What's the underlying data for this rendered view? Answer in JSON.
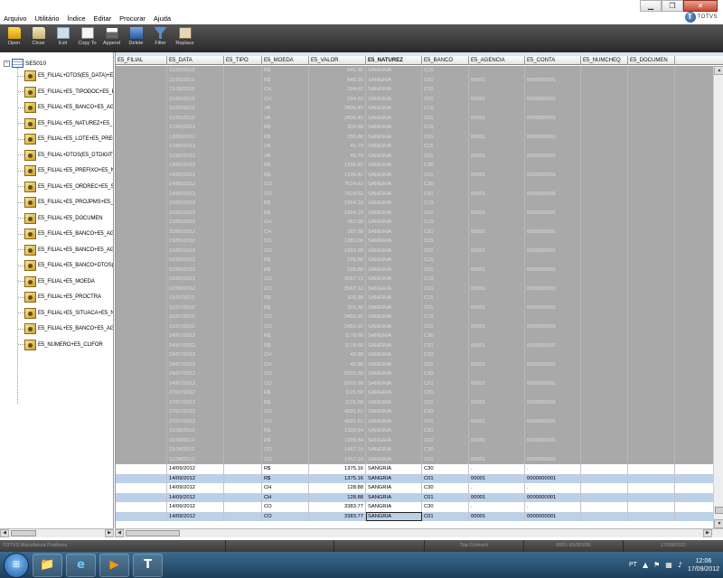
{
  "menu": [
    "Arquivo",
    "Utilitário",
    "Índice",
    "Editar",
    "Procurar",
    "Ajuda"
  ],
  "brand": "TOTVS",
  "toolbar": [
    {
      "label": "Open",
      "icon": "folder-open-icon"
    },
    {
      "label": "Close",
      "icon": "folder-close-icon"
    },
    {
      "label": "Exit",
      "icon": "exit-icon"
    },
    {
      "label": "Copy To",
      "icon": "copy-to-icon"
    },
    {
      "label": "Append",
      "icon": "append-icon"
    },
    {
      "label": "Delete",
      "icon": "delete-icon"
    },
    {
      "label": "Filter",
      "icon": "filter-icon"
    },
    {
      "label": "Replace",
      "icon": "replace-icon"
    }
  ],
  "tree": {
    "root": "SE5010",
    "items": [
      "E5_FILIAL+DTOS(E5_DATA)+E",
      "E5_FILIAL+E5_TIPODOC+E5_P",
      "E5_FILIAL+E5_BANCO+E5_AG",
      "E5_FILIAL+E5_NATUREZ+E5_",
      "E5_FILIAL+E5_LOTE+E5_PREF",
      "E5_FILIAL+DTOS(E5_DTDIGIT)",
      "E5_FILIAL+E5_PREFIXO+E5_N",
      "E5_FILIAL+E5_ORDREC+E5_SE",
      "E5_FILIAL+E5_PROJPMS+E5_",
      "E5_FILIAL+E5_DOCUMEN",
      "E5_FILIAL+E5_BANCO+E5_AG",
      "E5_FILIAL+E5_BANCO+E5_AG",
      "E5_FILIAL+E5_BANCO+DTOS(",
      "E5_FILIAL+E5_MOEDA",
      "E5_FILIAL+E5_PROCTRA",
      "E5_FILIAL+E5_SITUACA+E5_N",
      "E5_FILIAL+E5_BANCO+E5_AG",
      "E5_NUMERO+E5_CLIFOR"
    ]
  },
  "grid": {
    "columns": [
      "E5_FILIAL",
      "E5_DATA",
      "E5_TIPO",
      "E5_MOEDA",
      "E5_VALOR",
      "E5_NATUREZ",
      "E5_BANCO",
      "E5_AGENCIA",
      "E5_CONTA",
      "E5_NUMCHEQ",
      "E5_DOCUMEN"
    ],
    "active_column": "E5_NATUREZ",
    "rows": [
      [
        "",
        "11/05/2012",
        "",
        "R$",
        "845.36",
        "SANGRIA",
        "C15",
        "",
        "",
        "",
        ""
      ],
      [
        "",
        "11/05/2012",
        "",
        "R$",
        "845.36",
        "SANGRIA",
        "C01",
        "00001",
        "0000000001",
        "",
        ""
      ],
      [
        "",
        "11/05/2012",
        "",
        "CH",
        "294.62",
        "SANGRIA",
        "C15",
        "",
        "",
        "",
        ""
      ],
      [
        "",
        "11/05/2012",
        "",
        "CH",
        "294.62",
        "SANGRIA",
        "C01",
        "00001",
        "0000000001",
        "",
        ""
      ],
      [
        "",
        "11/05/2012",
        "",
        "VA",
        "2800.45",
        "SANGRIA",
        "C15",
        "",
        "",
        "",
        ""
      ],
      [
        "",
        "11/05/2012",
        "",
        "VA",
        "2800.45",
        "SANGRIA",
        "C01",
        "00001",
        "0000000001",
        "",
        ""
      ],
      [
        "",
        "12/05/2012",
        "",
        "R$",
        "200.88",
        "SANGRIA",
        "C15",
        "",
        "",
        "",
        ""
      ],
      [
        "",
        "12/05/2012",
        "",
        "R$",
        "200.88",
        "SANGRIA",
        "C01",
        "00001",
        "0000000001",
        "",
        ""
      ],
      [
        "",
        "12/05/2012",
        "",
        "VA",
        "45.79",
        "SANGRIA",
        "C15",
        "",
        "",
        "",
        ""
      ],
      [
        "",
        "12/05/2012",
        "",
        "VA",
        "45.79",
        "SANGRIA",
        "C01",
        "00001",
        "0000000001",
        "",
        ""
      ],
      [
        "",
        "14/05/2012",
        "",
        "R$",
        "1396.82",
        "SANGRIA",
        "C30",
        "",
        "",
        "",
        ""
      ],
      [
        "",
        "14/05/2012",
        "",
        "R$",
        "1396.82",
        "SANGRIA",
        "C01",
        "00001",
        "0000000001",
        "",
        ""
      ],
      [
        "",
        "14/05/2012",
        "",
        "CO",
        "7624.62",
        "SANGRIA",
        "C30",
        "",
        "",
        "",
        ""
      ],
      [
        "",
        "14/05/2012",
        "",
        "CO",
        "7624.62",
        "SANGRIA",
        "C01",
        "00001",
        "0000000001",
        "",
        ""
      ],
      [
        "",
        "23/05/2012",
        "",
        "R$",
        "1864.18",
        "SANGRIA",
        "C15",
        "",
        "",
        "",
        ""
      ],
      [
        "",
        "23/05/2012",
        "",
        "R$",
        "1864.18",
        "SANGRIA",
        "C01",
        "00001",
        "0000000001",
        "",
        ""
      ],
      [
        "",
        "23/05/2012",
        "",
        "CH",
        "367.58",
        "SANGRIA",
        "C15",
        "",
        "",
        "",
        ""
      ],
      [
        "",
        "23/05/2012",
        "",
        "CH",
        "367.58",
        "SANGRIA",
        "C01",
        "00001",
        "0000000001",
        "",
        ""
      ],
      [
        "",
        "23/05/2012",
        "",
        "CO",
        "1683.58",
        "SANGRIA",
        "C15",
        "",
        "",
        "",
        ""
      ],
      [
        "",
        "23/05/2012",
        "",
        "CO",
        "1683.58",
        "SANGRIA",
        "C01",
        "00001",
        "0000000001",
        "",
        ""
      ],
      [
        "",
        "02/06/2012",
        "",
        "R$",
        "226.88",
        "SANGRIA",
        "C15",
        "",
        "",
        "",
        ""
      ],
      [
        "",
        "02/06/2012",
        "",
        "R$",
        "226.88",
        "SANGRIA",
        "C01",
        "00001",
        "0000000001",
        "",
        ""
      ],
      [
        "",
        "02/06/2012",
        "",
        "CO",
        "3567.12",
        "SANGRIA",
        "C15",
        "",
        "",
        "",
        ""
      ],
      [
        "",
        "02/06/2012",
        "",
        "CO",
        "3567.12",
        "SANGRIA",
        "C01",
        "00001",
        "0000000001",
        "",
        ""
      ],
      [
        "",
        "11/07/2012",
        "",
        "R$",
        "326.38",
        "SANGRIA",
        "C15",
        "",
        "",
        "",
        ""
      ],
      [
        "",
        "11/07/2012",
        "",
        "R$",
        "326.38",
        "SANGRIA",
        "C01",
        "00001",
        "0000000001",
        "",
        ""
      ],
      [
        "",
        "11/07/2012",
        "",
        "CO",
        "3456.92",
        "SANGRIA",
        "C15",
        "",
        "",
        "",
        ""
      ],
      [
        "",
        "11/07/2012",
        "",
        "CO",
        "3456.92",
        "SANGRIA",
        "C01",
        "00001",
        "0000000001",
        "",
        ""
      ],
      [
        "",
        "24/07/2012",
        "",
        "R$",
        "1178.66",
        "SANGRIA",
        "C30",
        "",
        "",
        "",
        ""
      ],
      [
        "",
        "24/07/2012",
        "",
        "R$",
        "1178.66",
        "SANGRIA",
        "C01",
        "00001",
        "0000000001",
        "",
        ""
      ],
      [
        "",
        "24/07/2012",
        "",
        "CH",
        "46.88",
        "SANGRIA",
        "C30",
        "",
        "",
        "",
        ""
      ],
      [
        "",
        "24/07/2012",
        "",
        "CH",
        "46.88",
        "SANGRIA",
        "C01",
        "00001",
        "0000000001",
        "",
        ""
      ],
      [
        "",
        "24/07/2012",
        "",
        "CO",
        "5916.58",
        "SANGRIA",
        "C30",
        "",
        "",
        "",
        ""
      ],
      [
        "",
        "24/07/2012",
        "",
        "CO",
        "5916.58",
        "SANGRIA",
        "C01",
        "00001",
        "0000000001",
        "",
        ""
      ],
      [
        "",
        "27/07/2012",
        "",
        "R$",
        "1125.58",
        "SANGRIA",
        "C30",
        "",
        "",
        "",
        ""
      ],
      [
        "",
        "27/07/2012",
        "",
        "R$",
        "1125.58",
        "SANGRIA",
        "C01",
        "00001",
        "0000000001",
        "",
        ""
      ],
      [
        "",
        "27/07/2012",
        "",
        "CO",
        "4291.61",
        "SANGRIA",
        "C30",
        "",
        "",
        "",
        ""
      ],
      [
        "",
        "27/07/2012",
        "",
        "CO",
        "4291.61",
        "SANGRIA",
        "C01",
        "00001",
        "0000000001",
        "",
        ""
      ],
      [
        "",
        "11/08/2012",
        "",
        "R$",
        "1309.84",
        "SANGRIA",
        "C30",
        "",
        "",
        "",
        ""
      ],
      [
        "",
        "11/08/2012",
        "",
        "R$",
        "1309.84",
        "SANGRIA",
        "C01",
        "00001",
        "0000000001",
        "",
        ""
      ],
      [
        "",
        "11/08/2012",
        "",
        "CO",
        "1457.24",
        "SANGRIA",
        "C30",
        "",
        "",
        "",
        ""
      ],
      [
        "",
        "11/08/2012",
        "",
        "CO",
        "1457.24",
        "SANGRIA",
        "C01",
        "00001",
        "0000000001",
        "",
        ""
      ],
      [
        "",
        "14/09/2012",
        "",
        "R$",
        "1375.16",
        "SANGRIA",
        "C30",
        ".",
        ".",
        "",
        ""
      ],
      [
        "",
        "14/09/2012",
        "",
        "R$",
        "1375.16",
        "SANGRIA",
        "C01",
        "00001",
        "0000000001",
        "",
        ""
      ],
      [
        "",
        "14/09/2012",
        "",
        "CH",
        "128.88",
        "SANGRIA",
        "C30",
        ".",
        ".",
        "",
        ""
      ],
      [
        "",
        "14/09/2012",
        "",
        "CH",
        "128.88",
        "SANGRIA",
        "C01",
        "00001",
        "0000000001",
        "",
        ""
      ],
      [
        "",
        "14/09/2012",
        "",
        "CO",
        "3383.77",
        "SANGRIA",
        "C30",
        ".",
        ".",
        "",
        ""
      ],
      [
        "",
        "14/09/2012",
        "",
        "CO",
        "3383.77",
        "SANGRIA",
        "C01",
        "00001",
        "0000000001",
        "",
        ""
      ]
    ],
    "row_states": [
      "grey",
      "grey",
      "grey",
      "grey",
      "grey",
      "grey",
      "grey",
      "grey",
      "grey",
      "grey",
      "grey",
      "grey",
      "grey",
      "grey",
      "grey",
      "grey",
      "grey",
      "grey",
      "grey",
      "grey",
      "grey",
      "grey",
      "grey",
      "grey",
      "grey",
      "grey",
      "grey",
      "grey",
      "grey",
      "grey",
      "grey",
      "grey",
      "grey",
      "grey",
      "grey",
      "grey",
      "grey",
      "grey",
      "grey",
      "grey",
      "grey",
      "grey",
      "white",
      "sel",
      "white",
      "sel",
      "white",
      "sel"
    ],
    "focused_cell": {
      "row": 47,
      "column": "E5_NATUREZ"
    }
  },
  "status": {
    "app": "TOTVS Manufatura Protheus",
    "connection": "Top Connect",
    "session": "0001-X5/00X95",
    "date": "17/09/2012"
  },
  "taskbar": {
    "apps": [
      {
        "icon": "file-explorer-icon",
        "glyph": "📁"
      },
      {
        "icon": "internet-explorer-icon",
        "glyph": "e"
      },
      {
        "icon": "media-player-icon",
        "glyph": "▶"
      },
      {
        "icon": "totvs-app-icon",
        "glyph": "T"
      }
    ],
    "lang": "PT",
    "time": "12:06",
    "date": "17/09/2012"
  },
  "colors": {
    "grey_row": "#a9a9a9",
    "selected_row": "#bcd0e8",
    "toolbar": "#3a3a3a",
    "taskbar": "#2a5478"
  }
}
